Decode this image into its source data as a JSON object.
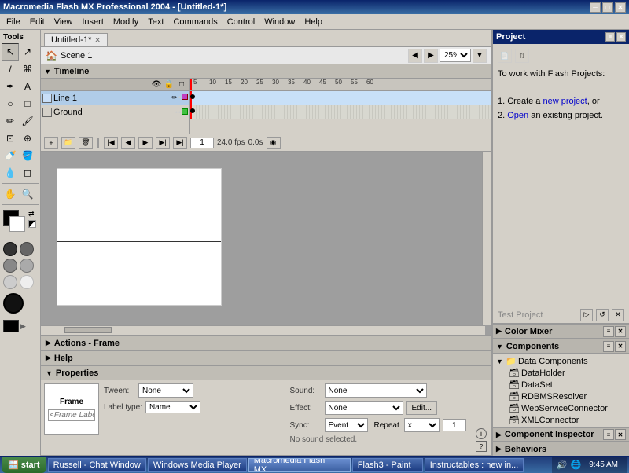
{
  "titleBar": {
    "title": "Macromedia Flash MX Professional 2004 - [Untitled-1*]",
    "minimize": "─",
    "maximize": "□",
    "close": "✕"
  },
  "menuBar": {
    "items": [
      "File",
      "Edit",
      "View",
      "Insert",
      "Modify",
      "Text",
      "Commands",
      "Control",
      "Window",
      "Help"
    ]
  },
  "docTab": {
    "label": "Untitled-1*",
    "close": "✕"
  },
  "scene": {
    "label": "Scene 1",
    "zoom": "25%"
  },
  "timeline": {
    "title": "Timeline",
    "layers": [
      {
        "name": "Line 1",
        "active": true
      },
      {
        "name": "Ground",
        "active": false
      }
    ],
    "frame": "1",
    "fps": "24.0 fps",
    "time": "0.0s"
  },
  "properties": {
    "title": "Properties",
    "frameLabel": "Frame",
    "frameLabelPlaceholder": "<Frame Label>",
    "tween": {
      "label": "Tween:",
      "value": "None"
    },
    "sound": {
      "label": "Sound:",
      "value": "None"
    },
    "effect": {
      "label": "Effect:",
      "value": "None"
    },
    "editBtn": "Edit...",
    "sync": {
      "label": "Sync:",
      "value": "Event"
    },
    "repeat": {
      "label": "Repeat",
      "value": "1"
    },
    "labelType": {
      "label": "Label type:",
      "value": "Name"
    },
    "noSound": "No sound selected."
  },
  "help": {
    "title": "Help"
  },
  "actions": {
    "title": "Actions - Frame"
  },
  "rightPanel": {
    "title": "Project",
    "projectText1": "To work with Flash Projects:",
    "projectText2": "1. Create a ",
    "newProjectLink": "new project",
    "projectText3": ", or",
    "projectText4": "2. ",
    "openLink": "Open",
    "projectText5": " an existing project."
  },
  "colorMixer": {
    "title": "Color Mixer"
  },
  "components": {
    "title": "Components",
    "tree": [
      {
        "label": "Data Components",
        "expanded": true,
        "children": [
          {
            "label": "DataHolder"
          },
          {
            "label": "DataSet"
          },
          {
            "label": "RDBMSResolver"
          },
          {
            "label": "WebServiceConnector"
          },
          {
            "label": "XMLConnector"
          }
        ]
      }
    ]
  },
  "componentInspector": {
    "title": "Component Inspector"
  },
  "behaviors": {
    "title": "Behaviors"
  },
  "taskbar": {
    "items": [
      {
        "label": "Russell - Chat Window",
        "active": false
      },
      {
        "label": "Windows Media Player",
        "active": false
      },
      {
        "label": "Macromedia Flash MX...",
        "active": true
      },
      {
        "label": "Flash3 - Paint",
        "active": false
      },
      {
        "label": "Instructables : new in...",
        "active": false
      }
    ],
    "time": "9:45 AM"
  },
  "frameMarkers": [
    "5",
    "10",
    "15",
    "20",
    "25",
    "30",
    "35",
    "40",
    "45",
    "50",
    "55",
    "60"
  ]
}
